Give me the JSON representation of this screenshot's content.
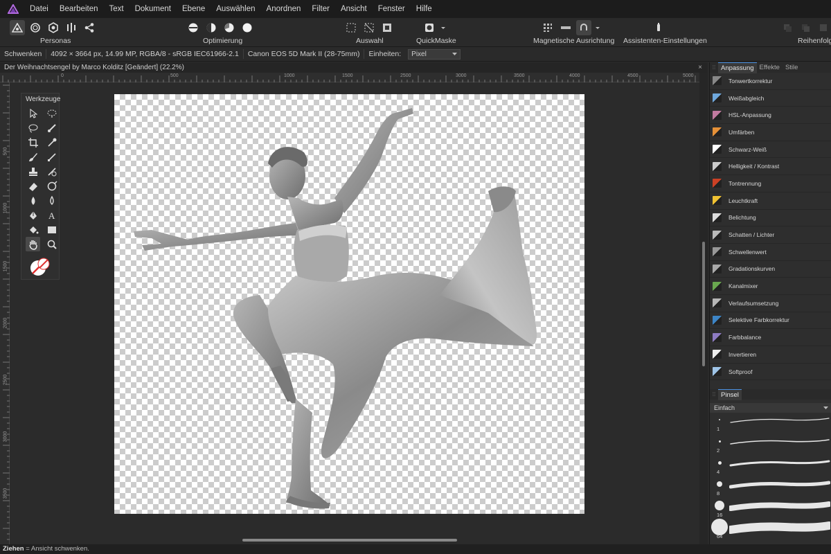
{
  "menu": [
    "Datei",
    "Bearbeiten",
    "Text",
    "Dokument",
    "Ebene",
    "Auswählen",
    "Anordnen",
    "Filter",
    "Ansicht",
    "Fenster",
    "Hilfe"
  ],
  "toolbar": {
    "personas_label": "Personas",
    "optimierung_label": "Optimierung",
    "auswahl_label": "Auswahl",
    "quickmaske_label": "QuickMaske",
    "magnetisch_label": "Magnetische Ausrichtung",
    "assistent_label": "Assistenten-Einstellungen",
    "reihenfolge_label": "Reihenfolge"
  },
  "context": {
    "tool": "Schwenken",
    "info": "4092 × 3664 px, 14.99 MP, RGBA/8 - sRGB IEC61966-2.1",
    "camera": "Canon EOS 5D Mark II (28-75mm)",
    "units_label": "Einheiten:",
    "units_value": "Pixel"
  },
  "document": {
    "title": "Der Weihnachtsengel by Marco Kolditz [Geändert] (22.2%)",
    "close": "×",
    "hruler_labels": [
      "0",
      "500",
      "1000",
      "1500",
      "2000",
      "2500",
      "3000",
      "3500",
      "4000",
      "4500",
      "5000"
    ],
    "vruler_labels": [
      "500",
      "1000",
      "1500",
      "2000",
      "2500",
      "3000",
      "3500"
    ]
  },
  "tools": {
    "title": "Werkzeuge"
  },
  "panels": {
    "tabs": [
      "Anpassung",
      "Effekte",
      "Stile"
    ],
    "adjustments": [
      {
        "label": "Tonwertkorrektur",
        "color": "#888888"
      },
      {
        "label": "Weißabgleich",
        "color": "#6fa8dc"
      },
      {
        "label": "HSL-Anpassung",
        "color": "#c27ba0"
      },
      {
        "label": "Umfärben",
        "color": "#e69138"
      },
      {
        "label": "Schwarz-Weiß",
        "color": "#ffffff"
      },
      {
        "label": "Helligkeit / Kontrast",
        "color": "#cccccc"
      },
      {
        "label": "Tontrennung",
        "color": "#cc4125"
      },
      {
        "label": "Leuchtkraft",
        "color": "#f1c232"
      },
      {
        "label": "Belichtung",
        "color": "#dddddd"
      },
      {
        "label": "Schatten / Lichter",
        "color": "#bbbbbb"
      },
      {
        "label": "Schwellenwert",
        "color": "#999999"
      },
      {
        "label": "Gradationskurven",
        "color": "#aaaaaa"
      },
      {
        "label": "Kanalmixer",
        "color": "#6aa84f"
      },
      {
        "label": "Verlaufsumsetzung",
        "color": "#b7b7b7"
      },
      {
        "label": "Selektive Farbkorrektur",
        "color": "#3d85c6"
      },
      {
        "label": "Farbbalance",
        "color": "#8e7cc3"
      },
      {
        "label": "Invertieren",
        "color": "#eeeeee"
      },
      {
        "label": "Softproof",
        "color": "#9fc5e8"
      }
    ],
    "brush_tab": "Pinsel",
    "brush_category": "Einfach",
    "brushes": [
      "1",
      "2",
      "4",
      "8",
      "16",
      "64"
    ]
  },
  "status": {
    "key": "Ziehen",
    "text": " = Ansicht schwenken."
  }
}
